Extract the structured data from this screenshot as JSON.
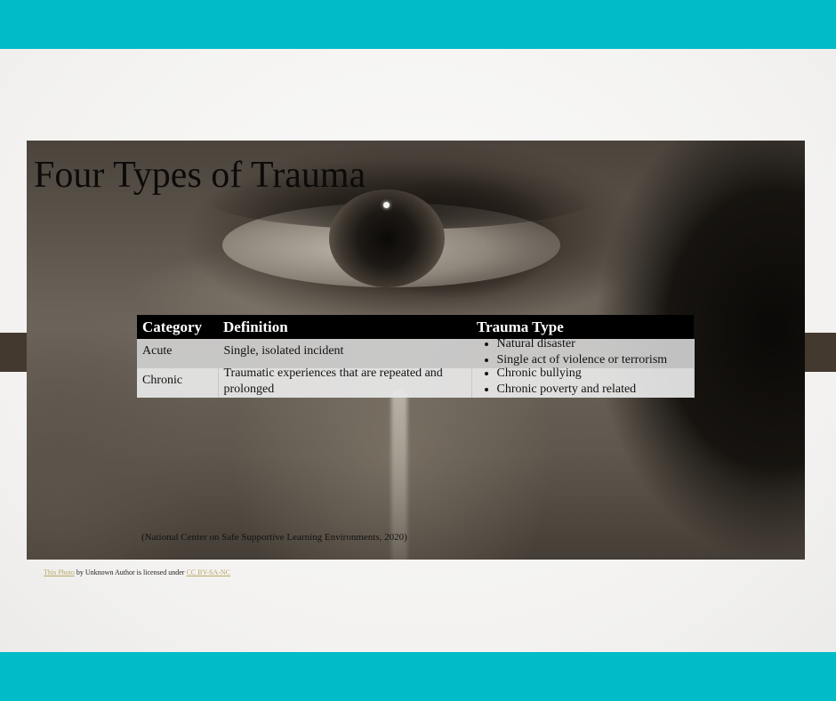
{
  "slide": {
    "title": "Four Types of Trauma",
    "citation": "(National Center on Safe Supportive Learning Environments, 2020)",
    "table": {
      "headers": [
        "Category",
        "Definition",
        "Trauma Type"
      ],
      "rows": [
        {
          "category": "Acute",
          "definition": "Single, isolated incident",
          "types": [
            "Natural disaster",
            "Single act of violence or terrorism"
          ]
        },
        {
          "category": "Chronic",
          "definition": "Traumatic experiences that are repeated and prolonged",
          "types": [
            "Chronic bullying",
            "Chronic poverty and related"
          ]
        }
      ]
    },
    "credit": {
      "link_text": "This Photo",
      "middle_text": " by Unknown Author is licensed under ",
      "license_text": "CC BY-SA-NC"
    }
  },
  "colors": {
    "accent_band": "#00bcc9",
    "stripe": "#43392f",
    "header_bg": "#000000"
  }
}
